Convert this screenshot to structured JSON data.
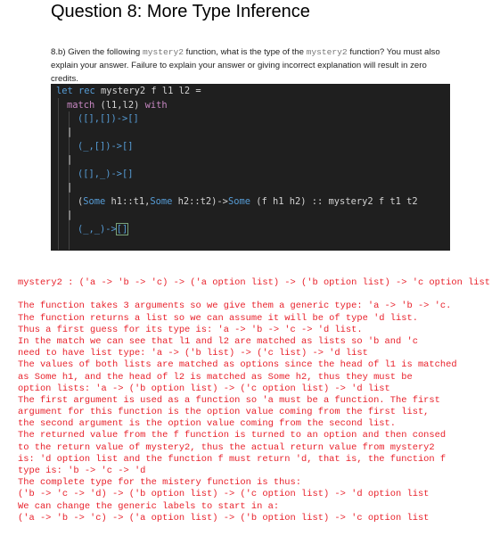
{
  "title": "Question 8: More Type Inference",
  "question": {
    "prefix": "8.b) Given the following ",
    "fn1": "mystery2",
    "mid": " function, what is the type of the ",
    "fn2": "mystery2",
    "suffix": " function? You must also explain your answer. Failure to explain your answer or giving incorrect explanation will result in zero credits."
  },
  "code": {
    "l1_kw": "let rec",
    "l1_rest": " mystery2 f l1 l2 =",
    "l2_kw1": "match",
    "l2_mid": " (l1,l2) ",
    "l2_kw2": "with",
    "l3": "([],[])->[]",
    "l5": "(_,[])->[]",
    "l7": "([],_)->[]",
    "l9_some1": "Some",
    "l9_a": " h1::t1,",
    "l9_some2": "Some",
    "l9_b": " h2::t2)->",
    "l9_some3": "Some",
    "l9_c": " (f h1 h2) :: mystery2 f t1 t2",
    "l11_a": "(_,_)->",
    "l11_b": "[]",
    "bar": "|"
  },
  "answer": {
    "lines": [
      "mystery2 : ('a -> 'b -> 'c) -> ('a option list) -> ('b option list) -> 'c option list",
      "",
      "The function takes 3 arguments so we give them a generic type: 'a -> 'b -> 'c.",
      "The function returns a list so we can assume it will be of type 'd list.",
      "Thus a first guess for its type is: 'a -> 'b -> 'c -> 'd list.",
      "In the match we can see that l1 and l2 are matched as lists so 'b and 'c",
      "need to have list type: 'a -> ('b list) -> ('c list) -> 'd list",
      "The values of both lists are matched as options since the head of l1 is matched",
      "as Some h1, and the head of l2 is matched as Some h2, thus they must be",
      "option lists: 'a -> ('b option list) -> ('c option list) -> 'd list",
      "The first argument is used as a function so 'a must be a function. The first",
      "argument for this function is the option value coming from the first list,",
      "the second argument is the option value coming from the second list.",
      "The returned value from the f function is turned to an option and then consed",
      "to the return value of mystery2, thus the actual return value from mystery2",
      "is: 'd option list and the function f must return 'd, that is, the function f",
      "type is: 'b -> 'c -> 'd",
      "The complete type for the mistery function is thus:",
      "('b -> 'c -> 'd) -> ('b option list) -> ('c option list) -> 'd option list",
      "We can change the generic labels to start in a:",
      "('a -> 'b -> 'c) -> ('a option list) -> ('b option list) -> 'c option list"
    ]
  },
  "colors": {
    "answer_text": "#e8212b",
    "code_bg": "#1f1f1f",
    "keyword": "#569cd6",
    "control_keyword": "#c586c0"
  }
}
